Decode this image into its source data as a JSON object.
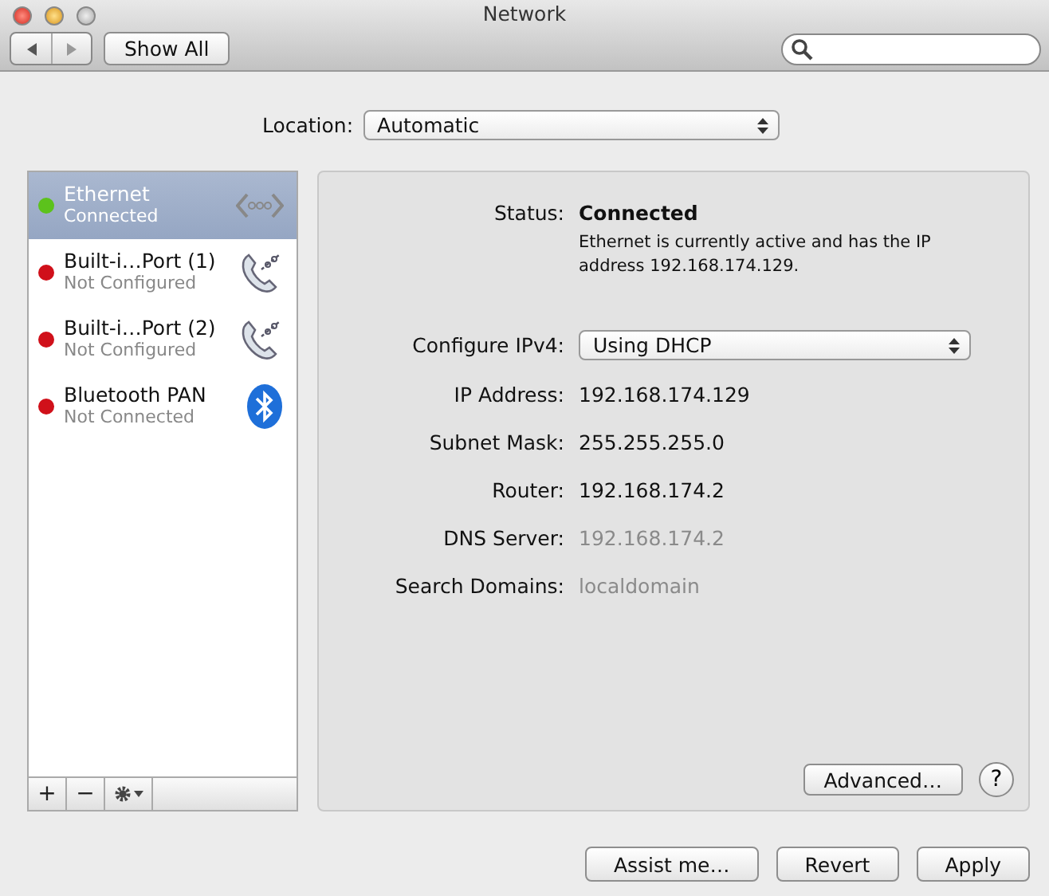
{
  "window": {
    "title": "Network"
  },
  "toolbar": {
    "show_all": "Show All"
  },
  "location": {
    "label": "Location:",
    "value": "Automatic"
  },
  "services": [
    {
      "name": "Ethernet",
      "status": "Connected",
      "color": "#5cc21c",
      "kind": "ethernet",
      "selected": true
    },
    {
      "name": "Built-i…Port (1)",
      "status": "Not Configured",
      "color": "#d0101a",
      "kind": "modem",
      "selected": false
    },
    {
      "name": "Built-i…Port (2)",
      "status": "Not Configured",
      "color": "#d0101a",
      "kind": "modem",
      "selected": false
    },
    {
      "name": "Bluetooth PAN",
      "status": "Not Connected",
      "color": "#d0101a",
      "kind": "bluetooth",
      "selected": false
    }
  ],
  "list_actions": [
    "+",
    "−"
  ],
  "status": {
    "label": "Status:",
    "value": "Connected",
    "note": "Ethernet is currently active and has the IP address 192.168.174.129."
  },
  "configure": {
    "label": "Configure IPv4:",
    "value": "Using DHCP"
  },
  "fields": [
    {
      "label": "IP Address:",
      "value": "192.168.174.129",
      "disabled": false
    },
    {
      "label": "Subnet Mask:",
      "value": "255.255.255.0",
      "disabled": false
    },
    {
      "label": "Router:",
      "value": "192.168.174.2",
      "disabled": false
    },
    {
      "label": "DNS Server:",
      "value": "192.168.174.2",
      "disabled": true
    },
    {
      "label": "Search Domains:",
      "value": "localdomain",
      "disabled": true
    }
  ],
  "advanced": "Advanced…",
  "help": "?",
  "buttons": [
    "Assist me…",
    "Revert",
    "Apply"
  ]
}
